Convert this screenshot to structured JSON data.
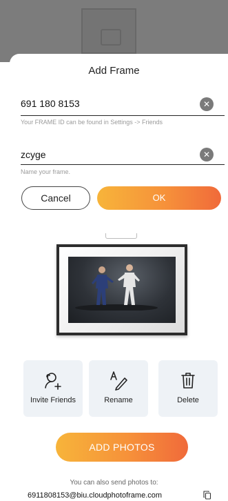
{
  "dialog": {
    "title": "Add Frame"
  },
  "frame_id_field": {
    "value": "691 180 8153",
    "hint": "Your FRAME ID can be found in Settings -> Friends"
  },
  "name_field": {
    "value": "zcyge",
    "hint": "Name your frame."
  },
  "buttons": {
    "cancel": "Cancel",
    "ok": "OK",
    "add_photos": "ADD PHOTOS"
  },
  "actions": [
    {
      "label": "Invite Friends",
      "icon": "invite-friends-icon"
    },
    {
      "label": "Rename",
      "icon": "rename-icon"
    },
    {
      "label": "Delete",
      "icon": "trash-icon"
    }
  ],
  "footer": {
    "note": "You can also send photos to:",
    "email": "6911808153@biu.cloudphotoframe.com"
  },
  "colors": {
    "accent_start": "#f7b43a",
    "accent_end": "#f06a3a"
  }
}
